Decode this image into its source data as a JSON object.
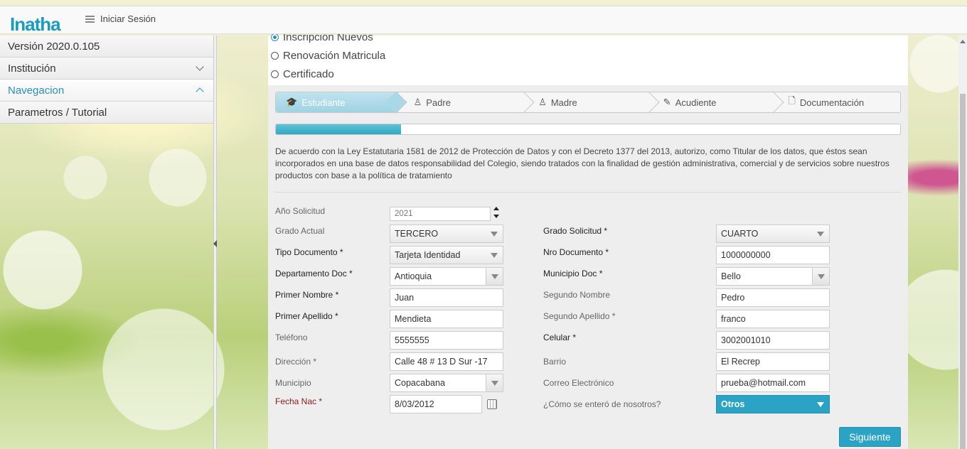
{
  "app": {
    "logo_text": "Inatha"
  },
  "topbar": {
    "menu_label": "Iniciar Sesión"
  },
  "sidebar": {
    "items": [
      {
        "label": "Versión 2020.0.105"
      },
      {
        "label": "Institución"
      },
      {
        "label": "Navegacion"
      },
      {
        "label": "Parametros / Tutorial"
      }
    ]
  },
  "registration_type": {
    "options": [
      {
        "label": "Inscripción Nuevos",
        "checked": true
      },
      {
        "label": "Renovación Matricula",
        "checked": false
      },
      {
        "label": "Certificado",
        "checked": false
      }
    ]
  },
  "wizard": {
    "steps": [
      {
        "label": "Estudiante",
        "icon": "graduation-cap-icon",
        "active": true
      },
      {
        "label": "Padre",
        "icon": "user-icon"
      },
      {
        "label": "Madre",
        "icon": "user-icon"
      },
      {
        "label": "Acudiente",
        "icon": "pencil-icon"
      },
      {
        "label": "Documentación",
        "icon": "document-icon"
      }
    ],
    "progress_fraction": 0.2
  },
  "legal_text": "De acuerdo con la Ley Estatutaria 1581 de 2012 de Protección de Datos y con el Decreto 1377 del 2013, autorizo, como Titular de los datos, que éstos sean incorporados en una base de datos responsabilidad del Colegio, siendo tratados con la finalidad de gestión administrativa, comercial y de servicios sobre nuestros productos con base a la política de tratamiento",
  "form": {
    "anio_solicitud": {
      "label": "Año Solicitud",
      "value": "2021"
    },
    "grado_actual": {
      "label": "Grado Actual",
      "value": "TERCERO"
    },
    "grado_solicitud": {
      "label": "Grado Solicitud *",
      "value": "CUARTO"
    },
    "tipo_documento": {
      "label": "Tipo Documento *",
      "value": "Tarjeta Identidad"
    },
    "nro_documento": {
      "label": "Nro Documento *",
      "value": "1000000000"
    },
    "departamento_doc": {
      "label": "Departamento Doc *",
      "value": "Antioquia"
    },
    "municipio_doc": {
      "label": "Municipio Doc *",
      "value": "Bello"
    },
    "primer_nombre": {
      "label": "Primer Nombre *",
      "value": "Juan"
    },
    "segundo_nombre": {
      "label": "Segundo Nombre",
      "value": "Pedro"
    },
    "primer_apellido": {
      "label": "Primer Apellido *",
      "value": "Mendieta"
    },
    "segundo_apellido": {
      "label": "Segundo Apellido *",
      "value": "franco"
    },
    "telefono": {
      "label": "Teléfono",
      "value": "5555555"
    },
    "celular": {
      "label": "Celular *",
      "value": "3002001010"
    },
    "direccion": {
      "label": "Dirección *",
      "value": "Calle 48 # 13 D Sur -17"
    },
    "barrio": {
      "label": "Barrio",
      "value": "El Recrep"
    },
    "municipio": {
      "label": "Municipio",
      "value": "Copacabana"
    },
    "correo": {
      "label": "Correo Electrónico",
      "value": "prueba@hotmail.com"
    },
    "fecha_nac": {
      "label": "Fecha Nac *",
      "value": "8/03/2012"
    },
    "como_se_entero": {
      "label": "¿Cómo se enteró de nosotros?",
      "value": "Otros"
    }
  },
  "actions": {
    "next_label": "Siguiente"
  },
  "colors": {
    "accent": "#2aa3c4",
    "active_nav": "#2a8fbd",
    "error_label": "#8a1b1b"
  }
}
